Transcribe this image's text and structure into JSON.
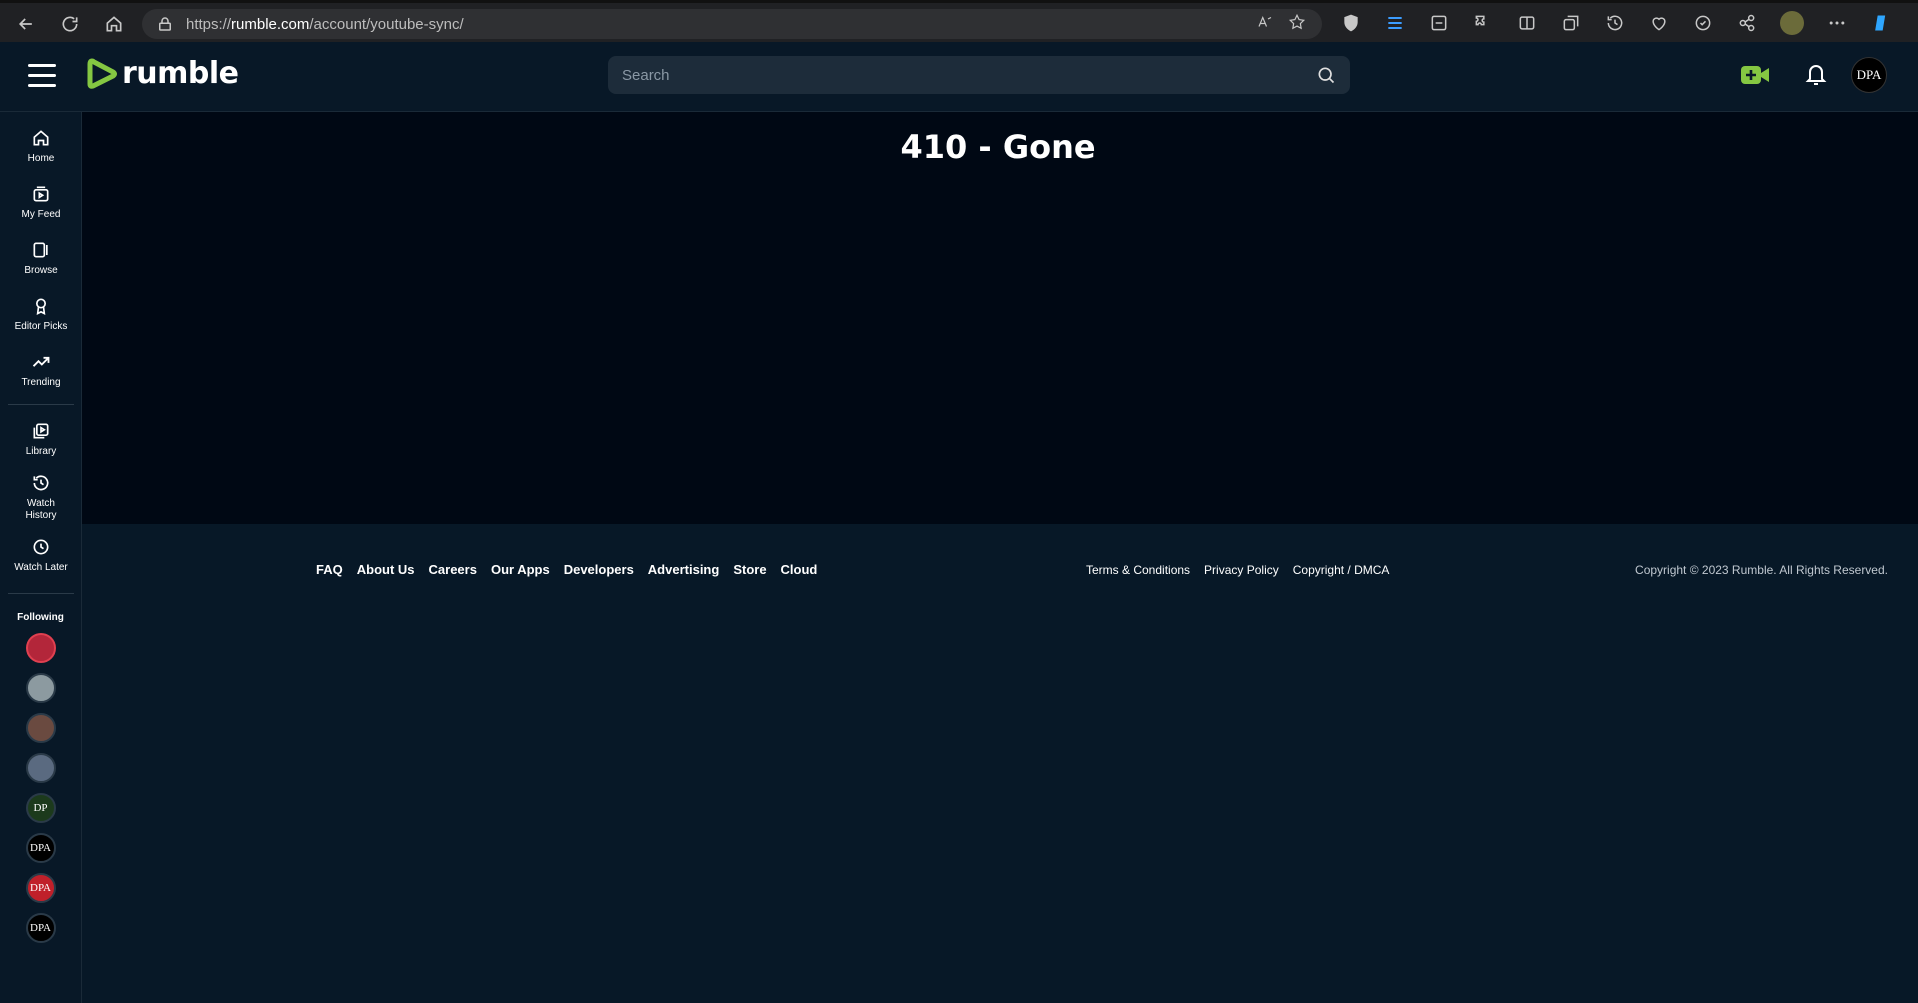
{
  "browser": {
    "url_prefix": "https://",
    "url_host": "rumble.com",
    "url_path": "/account/youtube-sync/"
  },
  "header": {
    "logo_text": "rumble",
    "search_placeholder": "Search",
    "user_initials": "DPA",
    "brand_color": "#85c742"
  },
  "sidebar": {
    "items": [
      {
        "label": "Home",
        "icon": "home-icon"
      },
      {
        "label": "My Feed",
        "icon": "feed-icon"
      },
      {
        "label": "Browse",
        "icon": "browse-icon"
      },
      {
        "label": "Editor Picks",
        "icon": "award-icon"
      },
      {
        "label": "Trending",
        "icon": "trending-icon"
      }
    ],
    "items2": [
      {
        "label": "Library",
        "icon": "library-icon"
      },
      {
        "label": "Watch History",
        "icon": "history-icon"
      },
      {
        "label": "Watch Later",
        "icon": "clock-icon"
      }
    ],
    "following_title": "Following",
    "following": [
      {
        "initials": "",
        "color": "#b3263a"
      },
      {
        "initials": "",
        "color": "#8c9aa0"
      },
      {
        "initials": "",
        "color": "#6a4a40"
      },
      {
        "initials": "",
        "color": "#5a6a80"
      },
      {
        "initials": "DP",
        "color": "#1c3a1c"
      },
      {
        "initials": "DPA",
        "color": "#000000"
      },
      {
        "initials": "DPA",
        "color": "#c0202a"
      },
      {
        "initials": "DPA",
        "color": "#000000"
      }
    ]
  },
  "main": {
    "error_title": "410 - Gone"
  },
  "footer": {
    "links": [
      "FAQ",
      "About Us",
      "Careers",
      "Our Apps",
      "Developers",
      "Advertising",
      "Store",
      "Cloud"
    ],
    "legal": [
      "Terms & Conditions",
      "Privacy Policy",
      "Copyright / DMCA"
    ],
    "copyright": "Copyright © 2023 Rumble. All Rights Reserved."
  }
}
